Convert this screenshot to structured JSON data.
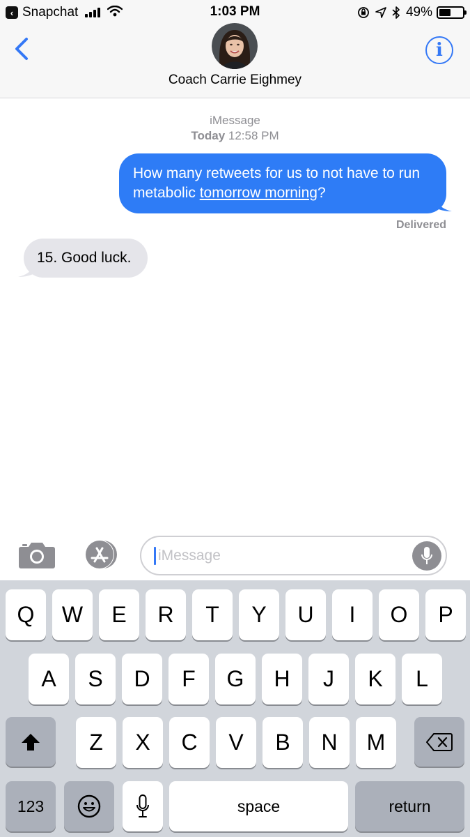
{
  "status_bar": {
    "back_app": "Snapchat",
    "time": "1:03 PM",
    "battery": "49%",
    "battery_level": 0.49
  },
  "header": {
    "contact_name": "Coach Carrie Eighmey",
    "info_label": "i"
  },
  "thread": {
    "service": "iMessage",
    "timestamp_day": "Today",
    "timestamp_time": "12:58 PM",
    "messages": [
      {
        "direction": "outgoing",
        "text_before": "How many retweets for us to not have to run metabolic ",
        "link_text": "tomorrow morning",
        "text_after": "?"
      },
      {
        "direction": "incoming",
        "text": "15. Good luck."
      }
    ],
    "delivery_status": "Delivered"
  },
  "composer": {
    "placeholder": "iMessage"
  },
  "keyboard": {
    "row1": [
      "Q",
      "W",
      "E",
      "R",
      "T",
      "Y",
      "U",
      "I",
      "O",
      "P"
    ],
    "row2": [
      "A",
      "S",
      "D",
      "F",
      "G",
      "H",
      "J",
      "K",
      "L"
    ],
    "row3": [
      "Z",
      "X",
      "C",
      "V",
      "B",
      "N",
      "M"
    ],
    "numbers_key": "123",
    "space_key": "space",
    "return_key": "return"
  },
  "colors": {
    "accent": "#3478f6",
    "outgoing_bubble": "#2e7cf6",
    "incoming_bubble": "#e5e5ea",
    "keyboard_bg": "#d1d5db"
  }
}
